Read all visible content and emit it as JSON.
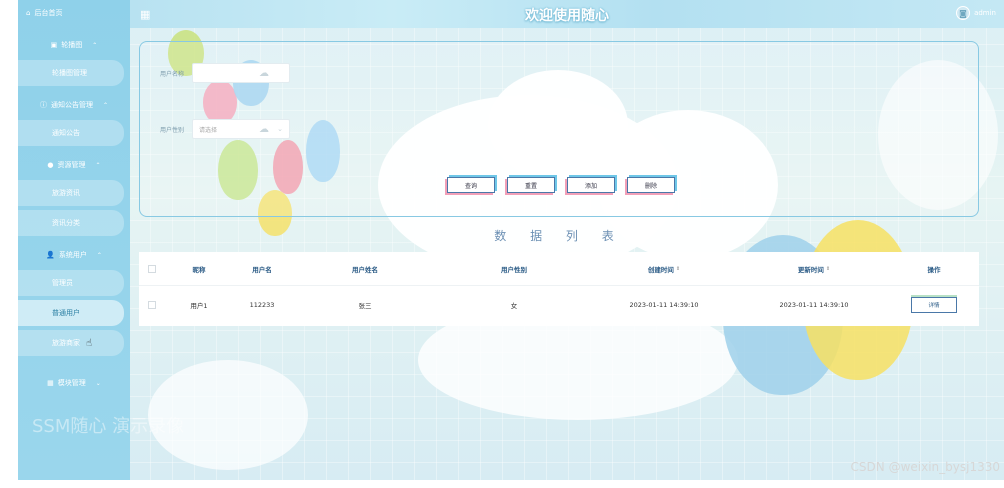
{
  "header": {
    "title": "欢迎使用随心",
    "user": "admin"
  },
  "sidebar": {
    "home": "后台首页",
    "groups": [
      {
        "label": "轮播图",
        "items": [
          "轮播图管理"
        ]
      },
      {
        "label": "通知公告管理",
        "items": [
          "通知公告"
        ]
      },
      {
        "label": "资源管理",
        "items": [
          "旅游资讯",
          "资讯分类"
        ]
      },
      {
        "label": "系统用户",
        "items": [
          "管理员",
          "普通用户",
          "旅游商家"
        ]
      },
      {
        "label": "模块管理",
        "items": []
      }
    ],
    "watermark": "SSM随心 演示录像"
  },
  "search": {
    "username_label": "用户名称",
    "gender_label": "用户性别",
    "gender_placeholder": "请选择",
    "buttons": {
      "query": "查询",
      "reset": "重置",
      "add": "添加",
      "delete": "删除"
    }
  },
  "table": {
    "title": "数 据 列 表",
    "columns": [
      "昵称",
      "用户名",
      "用户姓名",
      "用户性别",
      "创建时间",
      "更新时间",
      "操作"
    ],
    "rows": [
      {
        "nickname": "用户1",
        "username": "112233",
        "name": "张三",
        "gender": "女",
        "created": "2023-01-11 14:39:10",
        "updated": "2023-01-11 14:39:10",
        "action": "详情"
      }
    ]
  },
  "footer_watermark": "CSDN @weixin_bysj1330"
}
